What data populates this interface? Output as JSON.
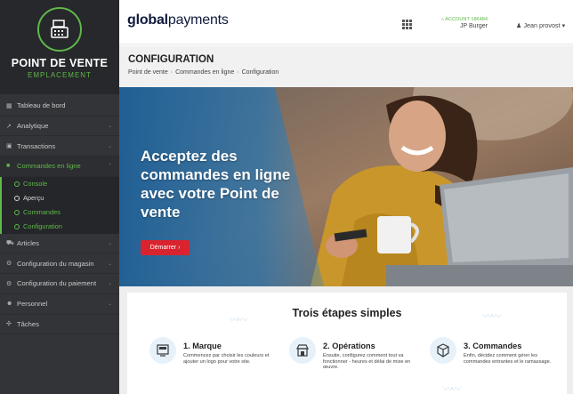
{
  "sidebar": {
    "brand_title": "POINT DE VENTE",
    "brand_subtitle": "EMPLACEMENT",
    "brand_icon": "cash-register-icon",
    "items": [
      {
        "label": "Tableau de bord",
        "icon": "dashboard-icon",
        "has_chevron": false
      },
      {
        "label": "Analytique",
        "icon": "chart-line-icon",
        "has_chevron": true
      },
      {
        "label": "Transactions",
        "icon": "money-icon",
        "has_chevron": true
      },
      {
        "label": "Commandes en ligne",
        "icon": "shopping-bag-icon",
        "has_chevron": true,
        "active": true
      }
    ],
    "subitems": [
      {
        "label": "Console",
        "active": true
      },
      {
        "label": "Aperçu",
        "active": false
      },
      {
        "label": "Commandes",
        "active": true
      },
      {
        "label": "Configuration",
        "active": true
      }
    ],
    "items_after": [
      {
        "label": "Articles",
        "icon": "cart-icon",
        "has_chevron": true
      },
      {
        "label": "Configuration du magasin",
        "icon": "gears-icon",
        "has_chevron": true
      },
      {
        "label": "Configuration du paiement",
        "icon": "gears-icon",
        "has_chevron": true
      },
      {
        "label": "Personnel",
        "icon": "users-icon",
        "has_chevron": true
      },
      {
        "label": "Tâches",
        "icon": "tasks-icon",
        "has_chevron": false
      }
    ]
  },
  "topbar": {
    "logo_bold": "global",
    "logo_rest": "payments",
    "account_number": "ACCOUNT 186484",
    "account_name": "JP Burger",
    "user_name": "Jean provost"
  },
  "page": {
    "title": "CONFIGURATION",
    "breadcrumb": [
      "Point de vente",
      "Commandes en ligne",
      "Configuration"
    ]
  },
  "hero": {
    "headline": "Acceptez des commandes en ligne avec votre Point de vente",
    "button_label": "Démarrer"
  },
  "steps": {
    "title": "Trois étapes simples",
    "items": [
      {
        "title": "1. Marque",
        "text": "Commencez par choisir les couleurs et ajouter un logo pour votre site.",
        "icon": "brand-screen-icon"
      },
      {
        "title": "2. Opérations",
        "text": "Ensuite, configurez comment tout va fonctionner - heures et délai de mise en œuvre.",
        "icon": "store-icon"
      },
      {
        "title": "3. Commandes",
        "text": "Enfin, décidez comment gérer les commandes entrantes et le ramassage.",
        "icon": "package-icon"
      }
    ]
  },
  "colors": {
    "accent_green": "#5fb84a",
    "sidebar_bg": "#333437",
    "cta_red": "#d9232e",
    "brand_navy": "#0f1b3d"
  }
}
